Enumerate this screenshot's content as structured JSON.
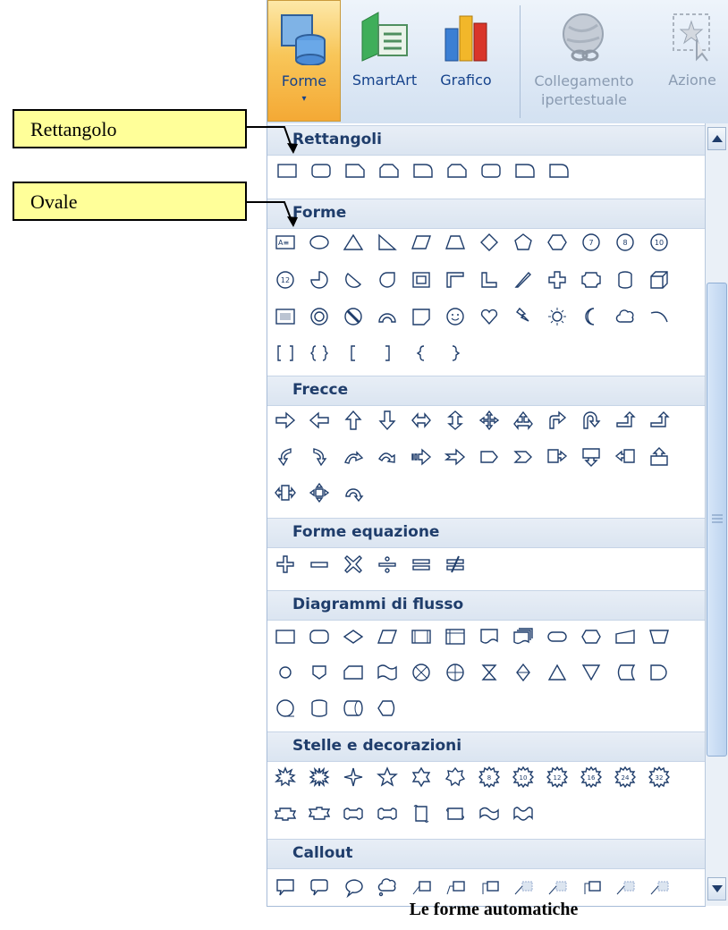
{
  "ribbon": {
    "forme": "Forme",
    "smartart": "SmartArt",
    "grafico": "Grafico",
    "collegamento_line1": "Collegamento",
    "collegamento_line2": "ipertestuale",
    "azione": "Azione",
    "caret": "▾"
  },
  "gallery": {
    "sections": {
      "rettangoli": "Rettangoli",
      "forme": "Forme",
      "frecce": "Frecce",
      "equazione": "Forme equazione",
      "flusso": "Diagrammi di flusso",
      "stelle": "Stelle e decorazioni",
      "callout": "Callout"
    },
    "star_badges": [
      "8",
      "10",
      "12",
      "16",
      "24",
      "32"
    ],
    "forme_badges": [
      "7",
      "8",
      "10",
      "12"
    ]
  },
  "labels": {
    "rettangolo": "Rettangolo",
    "ovale": "Ovale"
  },
  "caption": "Le forme automatiche",
  "colors": {
    "accent": "#f4a935",
    "section_text": "#1f3d6b",
    "callout_fill": "#ffff99",
    "shape_stroke": "#1f3d6b"
  }
}
